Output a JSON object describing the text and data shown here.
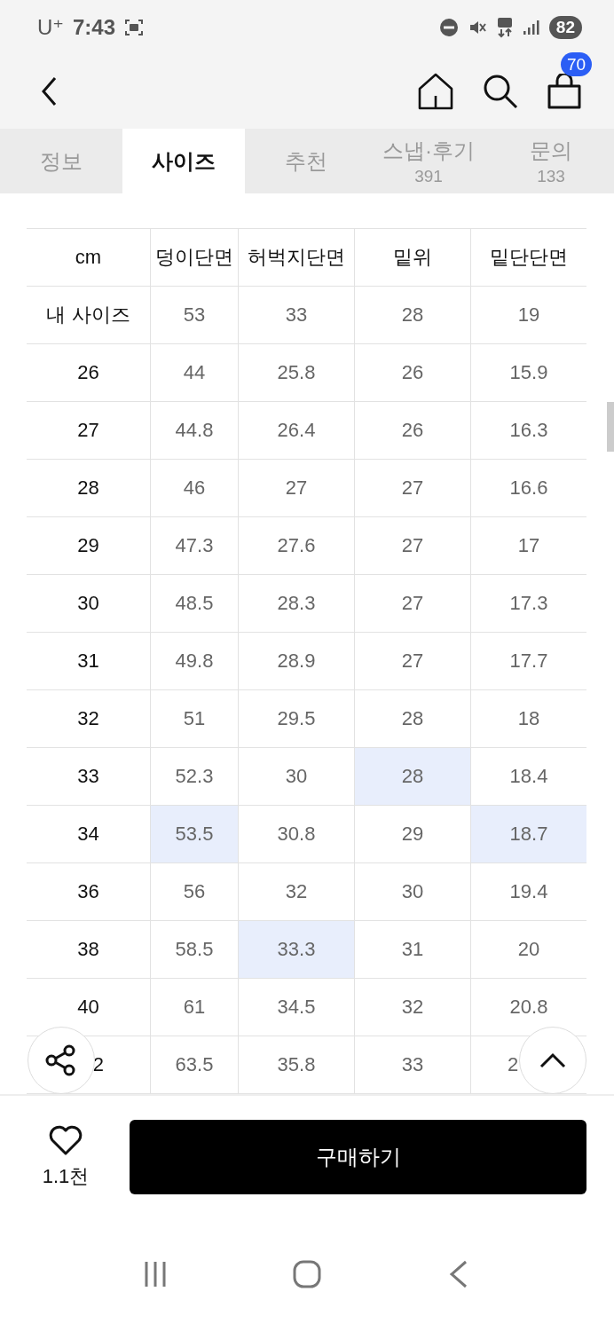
{
  "status_bar": {
    "carrier": "U⁺",
    "time": "7:43",
    "battery": "82"
  },
  "header": {
    "cart_count": "70"
  },
  "tabs": [
    {
      "label": "정보",
      "selected": false
    },
    {
      "label": "사이즈",
      "selected": true
    },
    {
      "label": "추천",
      "selected": false
    },
    {
      "label": "스냅·후기",
      "count": "391",
      "selected": false
    },
    {
      "label": "문의",
      "count": "133",
      "selected": false
    }
  ],
  "table": {
    "columns": [
      "cm",
      "덩이단면",
      "허벅지단면",
      "밑위",
      "밑단단면"
    ],
    "rows": [
      {
        "covered": false,
        "cells": [
          {
            "text": "내 사이즈",
            "highlighted": false
          },
          {
            "text": "53",
            "highlighted": false
          },
          {
            "text": "33",
            "highlighted": false
          },
          {
            "text": "28",
            "highlighted": false
          },
          {
            "text": "19",
            "highlighted": false
          }
        ]
      },
      {
        "covered": false,
        "cells": [
          {
            "text": "26",
            "highlighted": false
          },
          {
            "text": "44",
            "highlighted": false
          },
          {
            "text": "25.8",
            "highlighted": false
          },
          {
            "text": "26",
            "highlighted": false
          },
          {
            "text": "15.9",
            "highlighted": false
          }
        ]
      },
      {
        "covered": false,
        "cells": [
          {
            "text": "27",
            "highlighted": false
          },
          {
            "text": "44.8",
            "highlighted": false
          },
          {
            "text": "26.4",
            "highlighted": false
          },
          {
            "text": "26",
            "highlighted": false
          },
          {
            "text": "16.3",
            "highlighted": false
          }
        ]
      },
      {
        "covered": false,
        "cells": [
          {
            "text": "28",
            "highlighted": false
          },
          {
            "text": "46",
            "highlighted": false
          },
          {
            "text": "27",
            "highlighted": false
          },
          {
            "text": "27",
            "highlighted": false
          },
          {
            "text": "16.6",
            "highlighted": false
          }
        ]
      },
      {
        "covered": false,
        "cells": [
          {
            "text": "29",
            "highlighted": false
          },
          {
            "text": "47.3",
            "highlighted": false
          },
          {
            "text": "27.6",
            "highlighted": false
          },
          {
            "text": "27",
            "highlighted": false
          },
          {
            "text": "17",
            "highlighted": false
          }
        ]
      },
      {
        "covered": false,
        "cells": [
          {
            "text": "30",
            "highlighted": false
          },
          {
            "text": "48.5",
            "highlighted": false
          },
          {
            "text": "28.3",
            "highlighted": false
          },
          {
            "text": "27",
            "highlighted": false
          },
          {
            "text": "17.3",
            "highlighted": false
          }
        ]
      },
      {
        "covered": false,
        "cells": [
          {
            "text": "31",
            "highlighted": false
          },
          {
            "text": "49.8",
            "highlighted": false
          },
          {
            "text": "28.9",
            "highlighted": false
          },
          {
            "text": "27",
            "highlighted": false
          },
          {
            "text": "17.7",
            "highlighted": false
          }
        ]
      },
      {
        "covered": false,
        "cells": [
          {
            "text": "32",
            "highlighted": false
          },
          {
            "text": "51",
            "highlighted": false
          },
          {
            "text": "29.5",
            "highlighted": false
          },
          {
            "text": "28",
            "highlighted": false
          },
          {
            "text": "18",
            "highlighted": false
          }
        ]
      },
      {
        "covered": false,
        "cells": [
          {
            "text": "33",
            "highlighted": false
          },
          {
            "text": "52.3",
            "highlighted": false
          },
          {
            "text": "30",
            "highlighted": false
          },
          {
            "text": "28",
            "highlighted": true
          },
          {
            "text": "18.4",
            "highlighted": false
          }
        ]
      },
      {
        "covered": false,
        "cells": [
          {
            "text": "34",
            "highlighted": false
          },
          {
            "text": "53.5",
            "highlighted": true
          },
          {
            "text": "30.8",
            "highlighted": false
          },
          {
            "text": "29",
            "highlighted": false
          },
          {
            "text": "18.7",
            "highlighted": true
          }
        ]
      },
      {
        "covered": false,
        "cells": [
          {
            "text": "36",
            "highlighted": false
          },
          {
            "text": "56",
            "highlighted": false
          },
          {
            "text": "32",
            "highlighted": false
          },
          {
            "text": "30",
            "highlighted": false
          },
          {
            "text": "19.4",
            "highlighted": false
          }
        ]
      },
      {
        "covered": false,
        "cells": [
          {
            "text": "38",
            "highlighted": false
          },
          {
            "text": "58.5",
            "highlighted": false
          },
          {
            "text": "33.3",
            "highlighted": true
          },
          {
            "text": "31",
            "highlighted": false
          },
          {
            "text": "20",
            "highlighted": false
          }
        ]
      },
      {
        "covered": false,
        "cells": [
          {
            "text": "40",
            "highlighted": false
          },
          {
            "text": "61",
            "highlighted": false
          },
          {
            "text": "34.5",
            "highlighted": false
          },
          {
            "text": "32",
            "highlighted": false
          },
          {
            "text": "20.8",
            "highlighted": false
          }
        ]
      },
      {
        "covered": true,
        "cells": [
          {
            "text": "2",
            "highlighted": false
          },
          {
            "text": "63.5",
            "highlighted": false
          },
          {
            "text": "35.8",
            "highlighted": false
          },
          {
            "text": "33",
            "highlighted": false
          },
          {
            "text": "2",
            "highlighted": false
          }
        ]
      }
    ]
  },
  "bottom_bar": {
    "likes": "1.1천",
    "buy_button": "구매하기"
  }
}
